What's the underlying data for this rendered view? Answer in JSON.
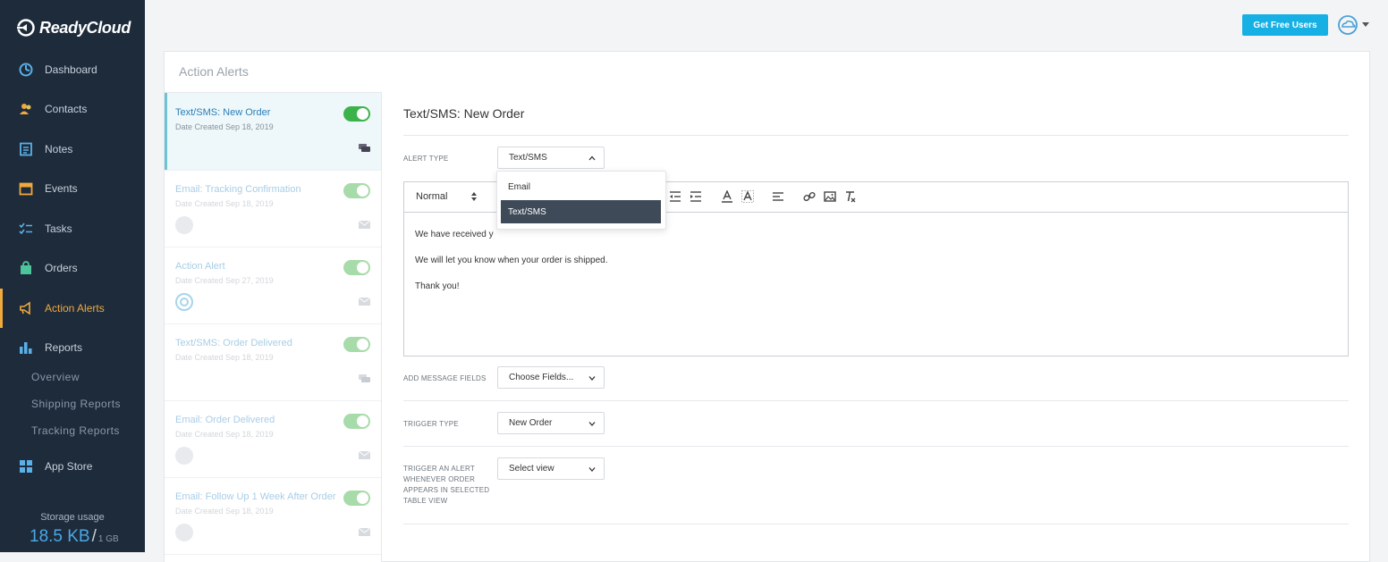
{
  "app": {
    "name": "ReadyCloud"
  },
  "sidebar": {
    "items": [
      {
        "label": "Dashboard",
        "icon": "dashboard-icon"
      },
      {
        "label": "Contacts",
        "icon": "contacts-icon"
      },
      {
        "label": "Notes",
        "icon": "notes-icon"
      },
      {
        "label": "Events",
        "icon": "calendar-icon"
      },
      {
        "label": "Tasks",
        "icon": "tasks-icon"
      },
      {
        "label": "Orders",
        "icon": "orders-icon"
      },
      {
        "label": "Action Alerts",
        "icon": "megaphone-icon",
        "active": true
      },
      {
        "label": "Reports",
        "icon": "bar-chart-icon"
      },
      {
        "label": "App Store",
        "icon": "grid-icon"
      }
    ],
    "report_subitems": [
      "Overview",
      "Shipping Reports",
      "Tracking Reports"
    ],
    "storage": {
      "label": "Storage usage",
      "used": "18.5 KB",
      "separator": "/",
      "capacity": "1 GB"
    }
  },
  "header": {
    "get_free_users_label": "Get Free Users",
    "accent_color": "#17b0e4"
  },
  "page": {
    "title": "Action Alerts"
  },
  "alerts": [
    {
      "name": "Text/SMS: New Order",
      "date": "Date Created Sep 18, 2019",
      "type": "sms",
      "enabled": true,
      "active": true
    },
    {
      "name": "Email: Tracking Confirmation",
      "date": "Date Created Sep 18, 2019",
      "type": "email",
      "enabled": true
    },
    {
      "name": "Action Alert",
      "date": "Date Created Sep 27, 2019",
      "type": "email",
      "enabled": true
    },
    {
      "name": "Text/SMS: Order Delivered",
      "date": "Date Created Sep 18, 2019",
      "type": "sms",
      "enabled": true
    },
    {
      "name": "Email: Order Delivered",
      "date": "Date Created Sep 18, 2019",
      "type": "email",
      "enabled": true
    },
    {
      "name": "Email: Follow Up 1 Week After Order",
      "date": "Date Created Sep 18, 2019",
      "type": "email",
      "enabled": true
    }
  ],
  "detail": {
    "title": "Text/SMS: New Order",
    "alert_type_label": "ALERT TYPE",
    "alert_type_value": "Text/SMS",
    "alert_type_options": [
      "Email",
      "Text/SMS"
    ],
    "editor": {
      "format": "Normal",
      "lines": [
        "We have received y",
        "We will let you know when your order is shipped.",
        "Thank you!"
      ]
    },
    "add_fields_label": "ADD MESSAGE FIELDS",
    "add_fields_value": "Choose Fields...",
    "trigger_type_label": "TRIGGER TYPE",
    "trigger_type_value": "New Order",
    "trigger_view_label": [
      "TRIGGER AN ALERT",
      "WHENEVER ORDER",
      "APPEARS IN SELECTED",
      "TABLE VIEW"
    ],
    "trigger_view_value": "Select view"
  }
}
